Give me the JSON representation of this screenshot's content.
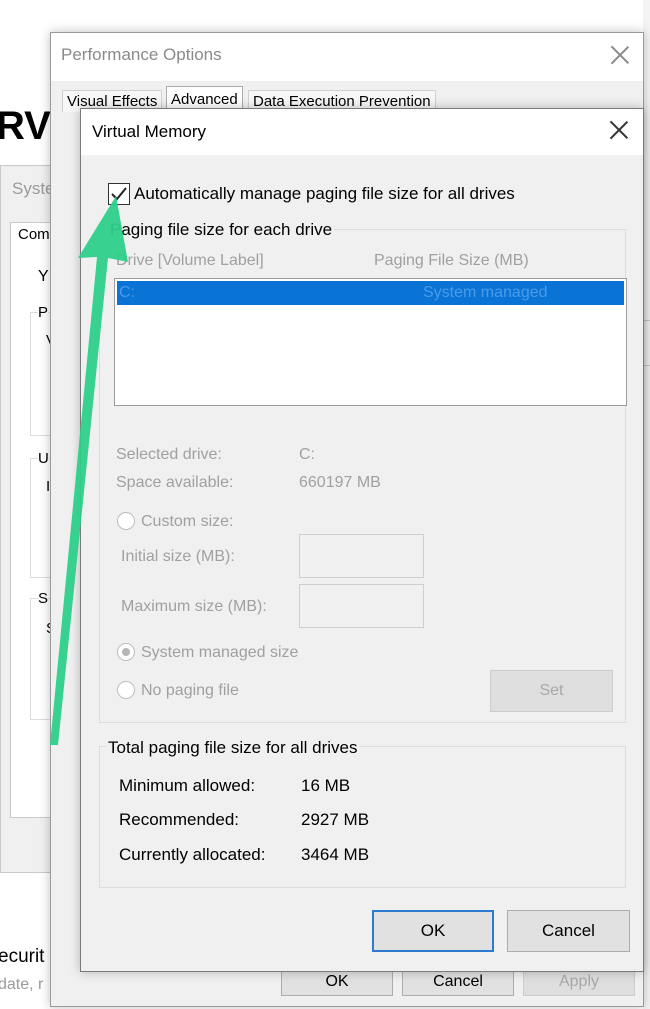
{
  "background": {
    "partial_heading": "RVI",
    "syst_text": "Syste",
    "tab_fragment": "Com",
    "fragment_y": "Y",
    "fragment_p": "P",
    "fragment_v": "V",
    "fragment_u": "U",
    "fragment_i": "I",
    "fragment_s": "S",
    "fragment_s2": "S",
    "bottom_line1": "ecurit",
    "bottom_line2": "date, r"
  },
  "performance_options": {
    "title": "Performance Options",
    "tabs": [
      "Visual Effects",
      "Advanced",
      "Data Execution Prevention"
    ],
    "buttons": {
      "ok": "OK",
      "cancel": "Cancel",
      "apply": "Apply"
    }
  },
  "virtual_memory": {
    "title": "Virtual Memory",
    "auto_manage_label": "Automatically manage paging file size for all drives",
    "auto_manage_checked": true,
    "paging_group_label": "Paging file size for each drive",
    "columns": {
      "drive": "Drive  [Volume Label]",
      "size": "Paging File Size (MB)"
    },
    "drives": [
      {
        "drive": "C:",
        "size": "System managed"
      }
    ],
    "selected_drive_label": "Selected drive:",
    "selected_drive_value": "C:",
    "space_available_label": "Space available:",
    "space_available_value": "660197 MB",
    "custom_size_label": "Custom size:",
    "initial_size_label": "Initial size (MB):",
    "initial_size_value": "",
    "maximum_size_label": "Maximum size (MB):",
    "maximum_size_value": "",
    "system_managed_label": "System managed size",
    "no_paging_label": "No paging file",
    "set_button": "Set",
    "total_group_label": "Total paging file size for all drives",
    "minimum_allowed_label": "Minimum allowed:",
    "minimum_allowed_value": "16 MB",
    "recommended_label": "Recommended:",
    "recommended_value": "2927 MB",
    "currently_allocated_label": "Currently allocated:",
    "currently_allocated_value": "3464 MB",
    "ok_button": "OK",
    "cancel_button": "Cancel"
  },
  "colors": {
    "selection": "#0a74d6",
    "arrow": "#2ecf8a",
    "default_button_border": "#2d7ad0"
  }
}
